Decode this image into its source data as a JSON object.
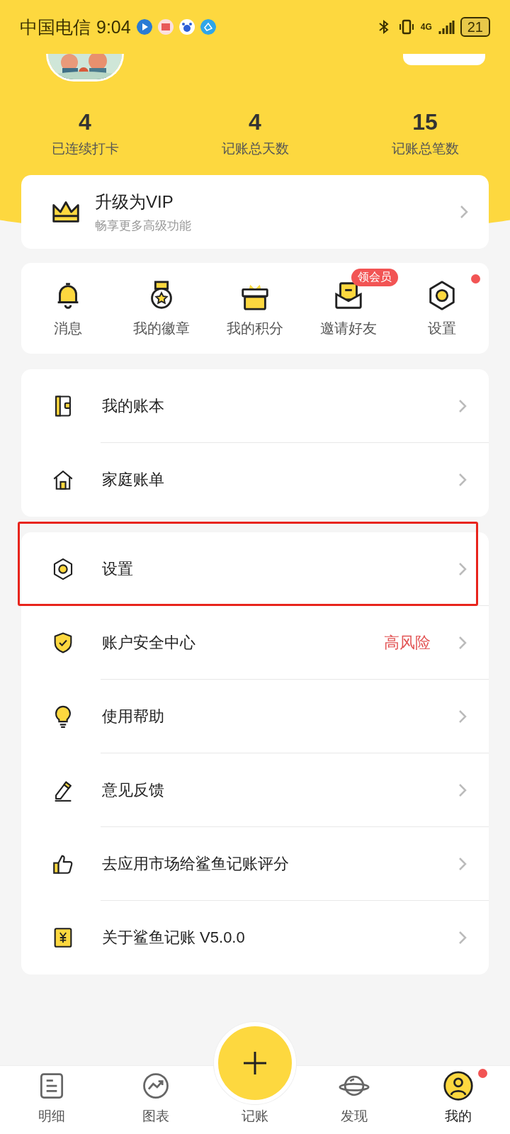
{
  "status_bar": {
    "carrier": "中国电信",
    "time": "9:04",
    "network": "4G",
    "battery": "21"
  },
  "stats": [
    {
      "value": "4",
      "label": "已连续打卡"
    },
    {
      "value": "4",
      "label": "记账总天数"
    },
    {
      "value": "15",
      "label": "记账总笔数"
    }
  ],
  "vip": {
    "title": "升级为VIP",
    "subtitle": "畅享更多高级功能"
  },
  "shortcuts": [
    {
      "kind": "bell",
      "label": "消息",
      "dot": false
    },
    {
      "kind": "medal",
      "label": "我的徽章",
      "dot": false
    },
    {
      "kind": "gift",
      "label": "我的积分",
      "dot": false
    },
    {
      "kind": "envelope",
      "label": "邀请好友",
      "badge": "领会员",
      "dot": false
    },
    {
      "kind": "gear",
      "label": "设置",
      "dot": true
    }
  ],
  "menu_groups": [
    [
      {
        "kind": "wallet",
        "label": "我的账本",
        "highlighted": false
      },
      {
        "kind": "house",
        "label": "家庭账单",
        "highlighted": false
      }
    ],
    [
      {
        "kind": "gear",
        "label": "设置",
        "highlighted": true
      },
      {
        "kind": "shield",
        "label": "账户安全中心",
        "value": "高风险",
        "highlighted": false
      },
      {
        "kind": "bulb",
        "label": "使用帮助",
        "highlighted": false
      },
      {
        "kind": "pen",
        "label": "意见反馈",
        "highlighted": false
      },
      {
        "kind": "thumb",
        "label": "去应用市场给鲨鱼记账评分",
        "highlighted": false
      },
      {
        "kind": "yen",
        "label": "关于鲨鱼记账 V5.0.0",
        "highlighted": false
      }
    ]
  ],
  "nav": [
    {
      "kind": "list",
      "label": "明细",
      "selected": false,
      "dot": false
    },
    {
      "kind": "chart",
      "label": "图表",
      "selected": false,
      "dot": false
    },
    {
      "kind": "add",
      "label": "记账",
      "selected": false,
      "dot": false
    },
    {
      "kind": "planet",
      "label": "发现",
      "selected": false,
      "dot": false
    },
    {
      "kind": "person",
      "label": "我的",
      "selected": true,
      "dot": true
    }
  ]
}
